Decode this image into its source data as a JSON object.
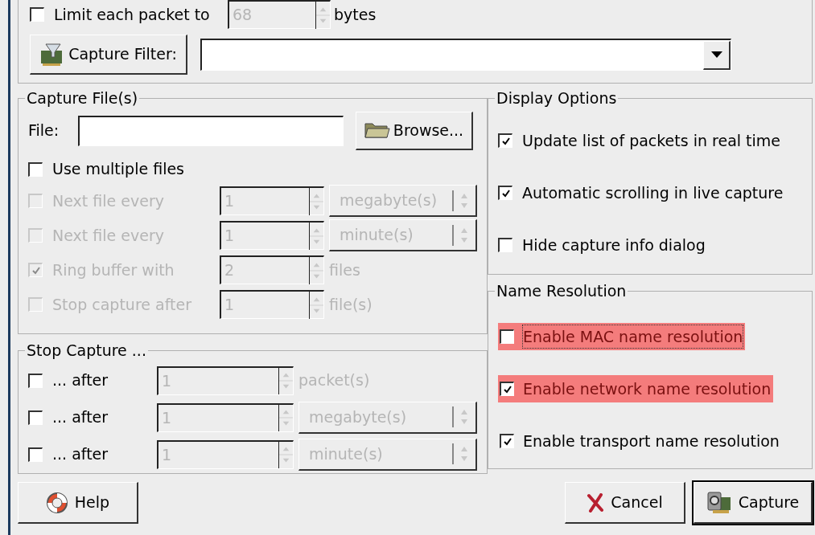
{
  "capture_limits": {
    "limit_packet": {
      "label": "Limit each packet to",
      "checked": false,
      "value": "68",
      "unit": "bytes",
      "field_disabled": true
    },
    "capture_filter": {
      "button": "Capture Filter:"
    }
  },
  "capture_files": {
    "title": "Capture File(s)",
    "file_label": "File:",
    "browse": "Browse...",
    "use_multiple": {
      "label": "Use multiple files",
      "checked": false
    },
    "rows": [
      {
        "label": "Next file every",
        "checked": false,
        "disabled": true,
        "value": "1",
        "unit": "megabyte(s)",
        "kind": "dropdown"
      },
      {
        "label": "Next file every",
        "checked": false,
        "disabled": true,
        "value": "1",
        "unit": "minute(s)",
        "kind": "dropdown"
      },
      {
        "label": "Ring buffer with",
        "checked": true,
        "disabled": true,
        "value": "2",
        "unit": "files",
        "kind": "text"
      },
      {
        "label": "Stop capture after",
        "checked": false,
        "disabled": true,
        "value": "1",
        "unit": "file(s)",
        "kind": "text"
      }
    ]
  },
  "stop_capture": {
    "title": "Stop Capture ...",
    "rows": [
      {
        "label": "... after",
        "checked": false,
        "disabled": false,
        "value": "1",
        "unit": "packet(s)",
        "kind": "text"
      },
      {
        "label": "... after",
        "checked": false,
        "disabled": false,
        "value": "1",
        "unit": "megabyte(s)",
        "kind": "dropdown"
      },
      {
        "label": "... after",
        "checked": false,
        "disabled": false,
        "value": "1",
        "unit": "minute(s)",
        "kind": "dropdown"
      }
    ]
  },
  "display_options": {
    "title": "Display Options",
    "items": [
      {
        "label": "Update list of packets in real time",
        "checked": true
      },
      {
        "label": "Automatic scrolling in live capture",
        "checked": true
      },
      {
        "label": "Hide capture info dialog",
        "checked": false
      }
    ]
  },
  "name_resolution": {
    "title": "Name Resolution",
    "items": [
      {
        "label": "Enable MAC name resolution",
        "checked": false,
        "highlighted": true,
        "focused": true
      },
      {
        "label": "Enable network name resolution",
        "checked": true,
        "highlighted": true,
        "focused": false
      },
      {
        "label": "Enable transport name resolution",
        "checked": true,
        "highlighted": false,
        "focused": false
      }
    ]
  },
  "buttons": [
    {
      "label": "Help",
      "kind": "help",
      "default": false
    },
    {
      "label": "Cancel",
      "kind": "cancel",
      "default": false
    },
    {
      "label": "Capture",
      "kind": "capture",
      "default": true
    }
  ]
}
